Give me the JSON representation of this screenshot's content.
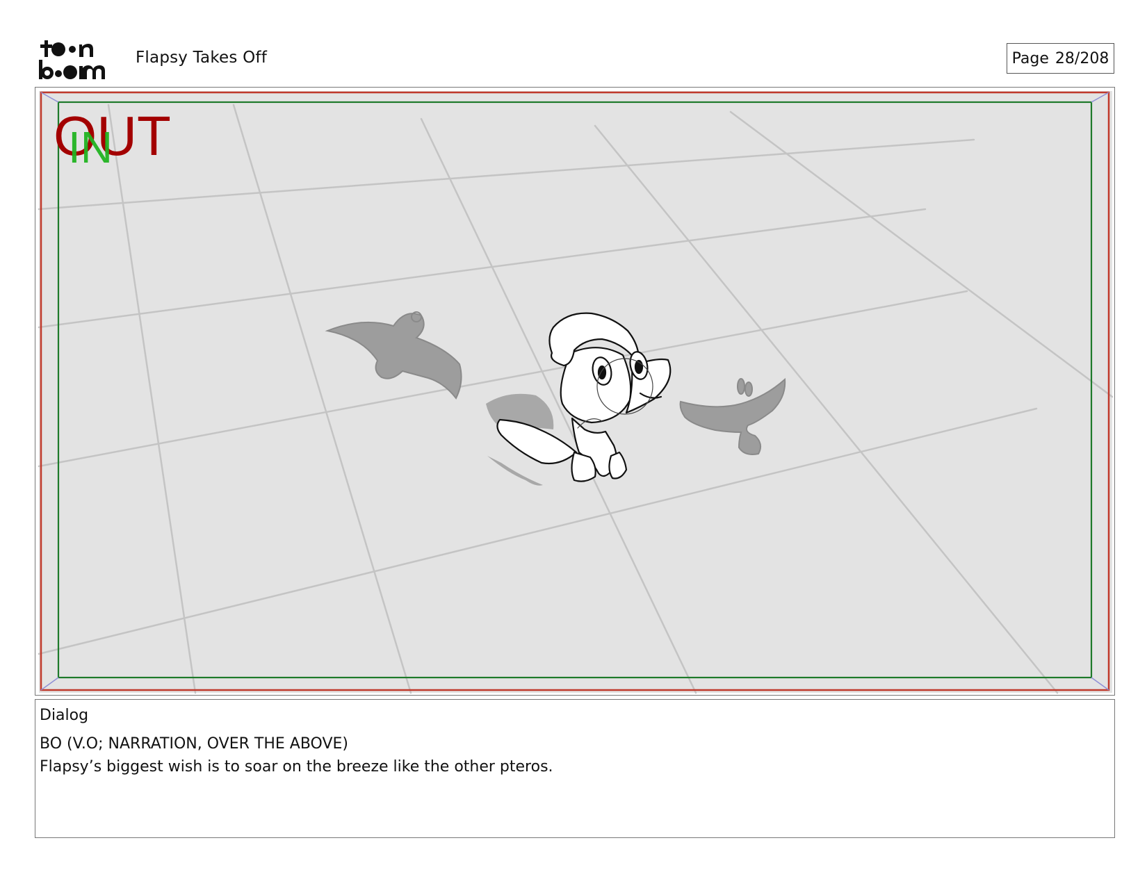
{
  "header": {
    "logo_text": "toon boom",
    "project_title": "Flapsy Takes Off",
    "page_label": "Page",
    "page_number": "28/208"
  },
  "panel": {
    "out_label": "OUT",
    "in_label": "IN",
    "colors": {
      "out_frame": "#c0392b",
      "in_frame": "#1e7a2a",
      "out_text": "#a30000",
      "in_text": "#22b422",
      "floor": "#e3e3e3",
      "grid": "#c4c4c4"
    }
  },
  "dialog": {
    "heading": "Dialog",
    "speaker": "BO (V.O; NARRATION, OVER THE ABOVE)",
    "line": "Flapsy’s biggest wish is to soar on the breeze like the other pteros."
  }
}
